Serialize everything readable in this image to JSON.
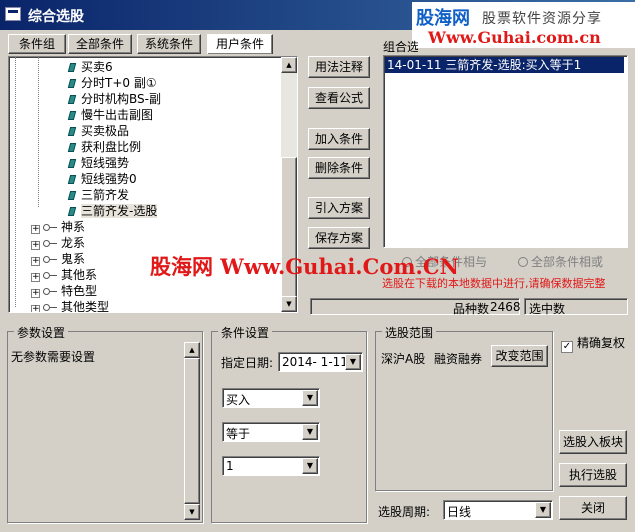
{
  "window": {
    "title": "综合选股"
  },
  "watermark": {
    "logo": "股海网",
    "slogan": "股票软件资源分享",
    "url": "Www.Guhai.com.cn",
    "center_text": "股海网 Www.Guhai.Com.CN"
  },
  "tabs": [
    {
      "label": "条件组"
    },
    {
      "label": "全部条件"
    },
    {
      "label": "系统条件"
    },
    {
      "label": "用户条件"
    }
  ],
  "tree": {
    "leaves": [
      "买卖6",
      "分时T+0 副①",
      "分时机构BS-副",
      "慢牛出击副图",
      "买卖极品",
      "获利盘比例",
      "短线强势",
      "短线强势0",
      "三箭齐发",
      "三箭齐发-选股"
    ],
    "groups": [
      "神系",
      "龙系",
      "鬼系",
      "其他系",
      "特色型",
      "其他类型"
    ]
  },
  "buttons": {
    "usage": "用法注释",
    "view_formula": "查看公式",
    "add_condition": "加入条件",
    "delete_condition": "删除条件",
    "import_plan": "引入方案",
    "save_plan": "保存方案",
    "change_range": "改变范围",
    "to_block": "选股入板块",
    "execute": "执行选股",
    "close": "关闭"
  },
  "combo_box": {
    "title": "组合选股条件",
    "items": [
      "14-01-11 三箭齐发-选股:买入等于1"
    ]
  },
  "logic": {
    "all_true": "全部条件相与",
    "all_or": "全部条件相或"
  },
  "notice": "选股在下载的本地数据中进行,请确保数据完整",
  "stats": {
    "count_label": "品种数",
    "count_value": "2468",
    "selected_label": "选中数"
  },
  "params": {
    "title": "参数设置",
    "text": "无参数需要设置"
  },
  "condition": {
    "title": "条件设置",
    "date_label": "指定日期:",
    "date_value": "2014- 1-11",
    "action": "买入",
    "op": "等于",
    "value": "1"
  },
  "range": {
    "title": "选股范围",
    "market": "深沪A股",
    "margin": "融资融券"
  },
  "exact_restore": "精确复权",
  "period": {
    "label": "选股周期:",
    "value": "日线"
  }
}
